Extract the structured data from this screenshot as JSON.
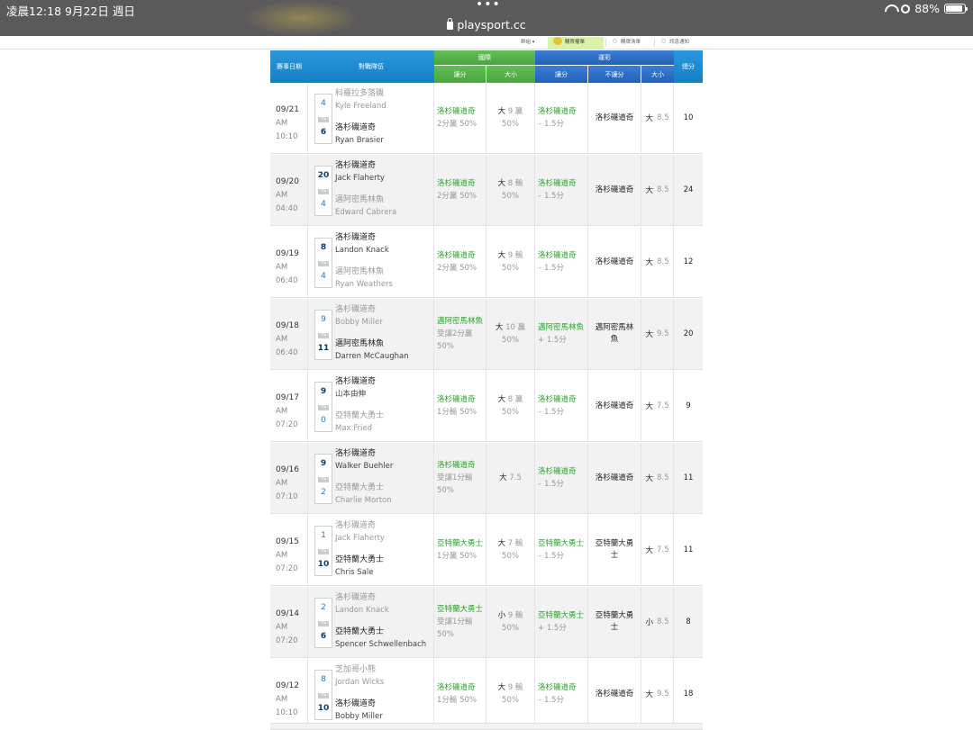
{
  "status_bar": {
    "time": "凌晨12:18   9月22日 週日",
    "dots": "•••",
    "url": "playsport.cc",
    "battery": "88%"
  },
  "subnav": {
    "item1": "群組",
    "item2": "購買權單",
    "item3": "購牌清單",
    "item4": "訊息通知"
  },
  "headers": {
    "date": "賽事日期",
    "match": "對戰隊伍",
    "intl": "國際",
    "tw": "運彩",
    "intl_spread": "讓分",
    "intl_ou": "大小",
    "tw_spread": "讓分",
    "tw_nospread": "不讓分",
    "tw_ou": "大小",
    "total": "總分"
  },
  "rows": [
    {
      "md": "09/21",
      "ampm": "AM",
      "tm": "10:10",
      "top": {
        "team": "科羅拉多落磯",
        "pitcher": "Kyle Freeland",
        "score": "4"
      },
      "bot": {
        "team": "洛杉磯道奇",
        "pitcher": "Ryan Brasier",
        "score": "6"
      },
      "intl_spread_team": "洛杉磯道奇",
      "intl_spread_res": "2分贏 50%",
      "intl_ou_dir": "大",
      "intl_ou_num": "9",
      "intl_ou_res": "贏",
      "intl_ou_pct": "50%",
      "tw_spread_team": "洛杉磯道奇",
      "tw_spread_line": "– 1.5分",
      "tw_nospread": "洛杉磯道奇",
      "tw_ou_dir": "大",
      "tw_ou_num": "8.5",
      "total": "10"
    },
    {
      "md": "09/20",
      "ampm": "AM",
      "tm": "04:40",
      "top": {
        "team": "洛杉磯道奇",
        "pitcher": "Jack Flaherty",
        "score": "20"
      },
      "bot": {
        "team": "邁阿密馬林魚",
        "pitcher": "Edward Cabrera",
        "score": "4"
      },
      "intl_spread_team": "洛杉磯道奇",
      "intl_spread_res": "2分贏 50%",
      "intl_ou_dir": "大",
      "intl_ou_num": "8",
      "intl_ou_res": "輸",
      "intl_ou_pct": "50%",
      "tw_spread_team": "洛杉磯道奇",
      "tw_spread_line": "– 1.5分",
      "tw_nospread": "洛杉磯道奇",
      "tw_ou_dir": "大",
      "tw_ou_num": "8.5",
      "total": "24"
    },
    {
      "md": "09/19",
      "ampm": "AM",
      "tm": "06:40",
      "top": {
        "team": "洛杉磯道奇",
        "pitcher": "Landon Knack",
        "score": "8"
      },
      "bot": {
        "team": "邁阿密馬林魚",
        "pitcher": "Ryan Weathers",
        "score": "4"
      },
      "intl_spread_team": "洛杉磯道奇",
      "intl_spread_res": "2分贏 50%",
      "intl_ou_dir": "大",
      "intl_ou_num": "9",
      "intl_ou_res": "輸",
      "intl_ou_pct": "50%",
      "tw_spread_team": "洛杉磯道奇",
      "tw_spread_line": "– 1.5分",
      "tw_nospread": "洛杉磯道奇",
      "tw_ou_dir": "大",
      "tw_ou_num": "8.5",
      "total": "12"
    },
    {
      "md": "09/18",
      "ampm": "AM",
      "tm": "06:40",
      "top": {
        "team": "洛杉磯道奇",
        "pitcher": "Bobby Miller",
        "score": "9"
      },
      "bot": {
        "team": "邁阿密馬林魚",
        "pitcher": "Darren McCaughan",
        "score": "11"
      },
      "intl_spread_team": "邁阿密馬林魚",
      "intl_spread_res": "受讓2分贏 50%",
      "intl_ou_dir": "大",
      "intl_ou_num": "10",
      "intl_ou_res": "贏",
      "intl_ou_pct": "50%",
      "tw_spread_team": "邁阿密馬林魚",
      "tw_spread_line": "+ 1.5分",
      "tw_nospread": "邁阿密馬林魚",
      "tw_ou_dir": "大",
      "tw_ou_num": "9.5",
      "total": "20"
    },
    {
      "md": "09/17",
      "ampm": "AM",
      "tm": "07:20",
      "top": {
        "team": "洛杉磯道奇",
        "pitcher": "山本由伸",
        "score": "9"
      },
      "bot": {
        "team": "亞特蘭大勇士",
        "pitcher": "Max Fried",
        "score": "0"
      },
      "intl_spread_team": "洛杉磯道奇",
      "intl_spread_res": "1分輸 50%",
      "intl_ou_dir": "大",
      "intl_ou_num": "8",
      "intl_ou_res": "贏",
      "intl_ou_pct": "50%",
      "tw_spread_team": "洛杉磯道奇",
      "tw_spread_line": "– 1.5分",
      "tw_nospread": "洛杉磯道奇",
      "tw_ou_dir": "大",
      "tw_ou_num": "7.5",
      "total": "9"
    },
    {
      "md": "09/16",
      "ampm": "AM",
      "tm": "07:10",
      "top": {
        "team": "洛杉磯道奇",
        "pitcher": "Walker Buehler",
        "score": "9"
      },
      "bot": {
        "team": "亞特蘭大勇士",
        "pitcher": "Charlie Morton",
        "score": "2"
      },
      "intl_spread_team": "洛杉磯道奇",
      "intl_spread_res": "受讓1分輸 50%",
      "intl_ou_dir": "大",
      "intl_ou_num": "7.5",
      "intl_ou_res": "",
      "intl_ou_pct": "",
      "tw_spread_team": "洛杉磯道奇",
      "tw_spread_line": "– 1.5分",
      "tw_nospread": "洛杉磯道奇",
      "tw_ou_dir": "大",
      "tw_ou_num": "8.5",
      "total": "11"
    },
    {
      "md": "09/15",
      "ampm": "AM",
      "tm": "07:20",
      "top": {
        "team": "洛杉磯道奇",
        "pitcher": "Jack Flaherty",
        "score": "1"
      },
      "bot": {
        "team": "亞特蘭大勇士",
        "pitcher": "Chris Sale",
        "score": "10"
      },
      "intl_spread_team": "亞特蘭大勇士",
      "intl_spread_res": "1分贏 50%",
      "intl_ou_dir": "大",
      "intl_ou_num": "7",
      "intl_ou_res": "輸",
      "intl_ou_pct": "50%",
      "tw_spread_team": "亞特蘭大勇士",
      "tw_spread_line": "– 1.5分",
      "tw_nospread": "亞特蘭大勇士",
      "tw_ou_dir": "大",
      "tw_ou_num": "7.5",
      "total": "11"
    },
    {
      "md": "09/14",
      "ampm": "AM",
      "tm": "07:20",
      "top": {
        "team": "洛杉磯道奇",
        "pitcher": "Landon Knack",
        "score": "2"
      },
      "bot": {
        "team": "亞特蘭大勇士",
        "pitcher": "Spencer Schwellenbach",
        "score": "6"
      },
      "intl_spread_team": "亞特蘭大勇士",
      "intl_spread_res": "受讓1分輸 50%",
      "intl_ou_dir": "小",
      "intl_ou_num": "9",
      "intl_ou_res": "輸",
      "intl_ou_pct": "50%",
      "tw_spread_team": "亞特蘭大勇士",
      "tw_spread_line": "+ 1.5分",
      "tw_nospread": "亞特蘭大勇士",
      "tw_ou_dir": "小",
      "tw_ou_num": "8.5",
      "total": "8"
    },
    {
      "md": "09/12",
      "ampm": "AM",
      "tm": "10:10",
      "top": {
        "team": "芝加哥小熊",
        "pitcher": "Jordan Wicks",
        "score": "8"
      },
      "bot": {
        "team": "洛杉磯道奇",
        "pitcher": "Bobby Miller",
        "score": "10"
      },
      "intl_spread_team": "洛杉磯道奇",
      "intl_spread_res": "1分輸 50%",
      "intl_ou_dir": "大",
      "intl_ou_num": "9",
      "intl_ou_res": "輸",
      "intl_ou_pct": "50%",
      "tw_spread_team": "洛杉磯道奇",
      "tw_spread_line": "– 1.5分",
      "tw_nospread": "洛杉磯道奇",
      "tw_ou_dir": "大",
      "tw_ou_num": "9.5",
      "total": "18"
    }
  ]
}
